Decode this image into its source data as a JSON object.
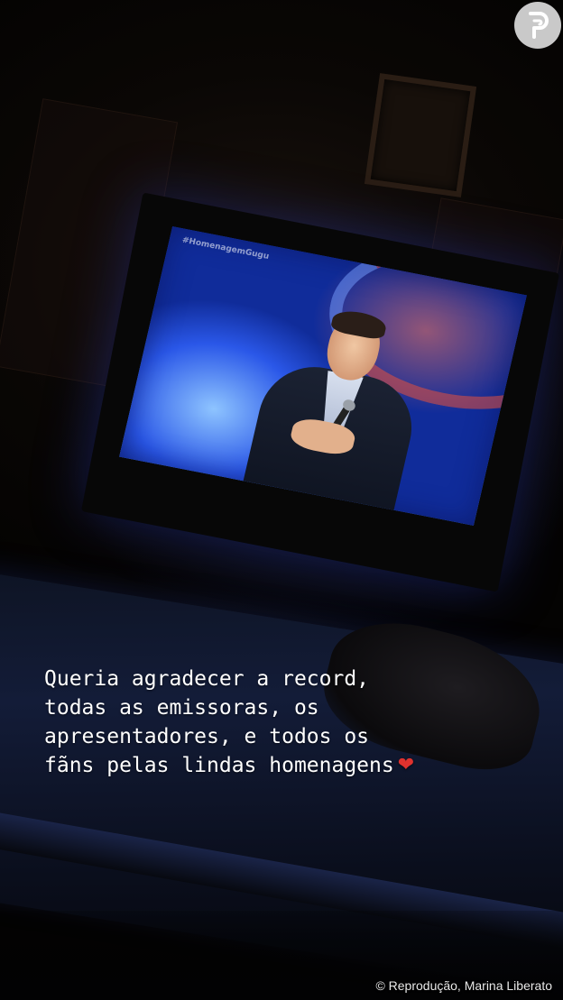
{
  "story": {
    "caption_lines": [
      "Queria agradecer a record,",
      "todas as emissoras, os",
      "apresentadores, e todos os",
      "fãns pelas lindas homenagens"
    ],
    "caption_emoji_icon": "red-heart-icon"
  },
  "tv": {
    "hashtag": "#HomenagemGugu"
  },
  "watermark": {
    "logo_icon": "purepeople-p-logo",
    "logo_letter": "P"
  },
  "credit": {
    "text": "© Reprodução, Marina Liberato"
  },
  "colors": {
    "caption_text": "#ffffff",
    "heart": "#e0322e",
    "logo_badge": "#c9c9c9",
    "tv_glow": "#2a57e8"
  }
}
